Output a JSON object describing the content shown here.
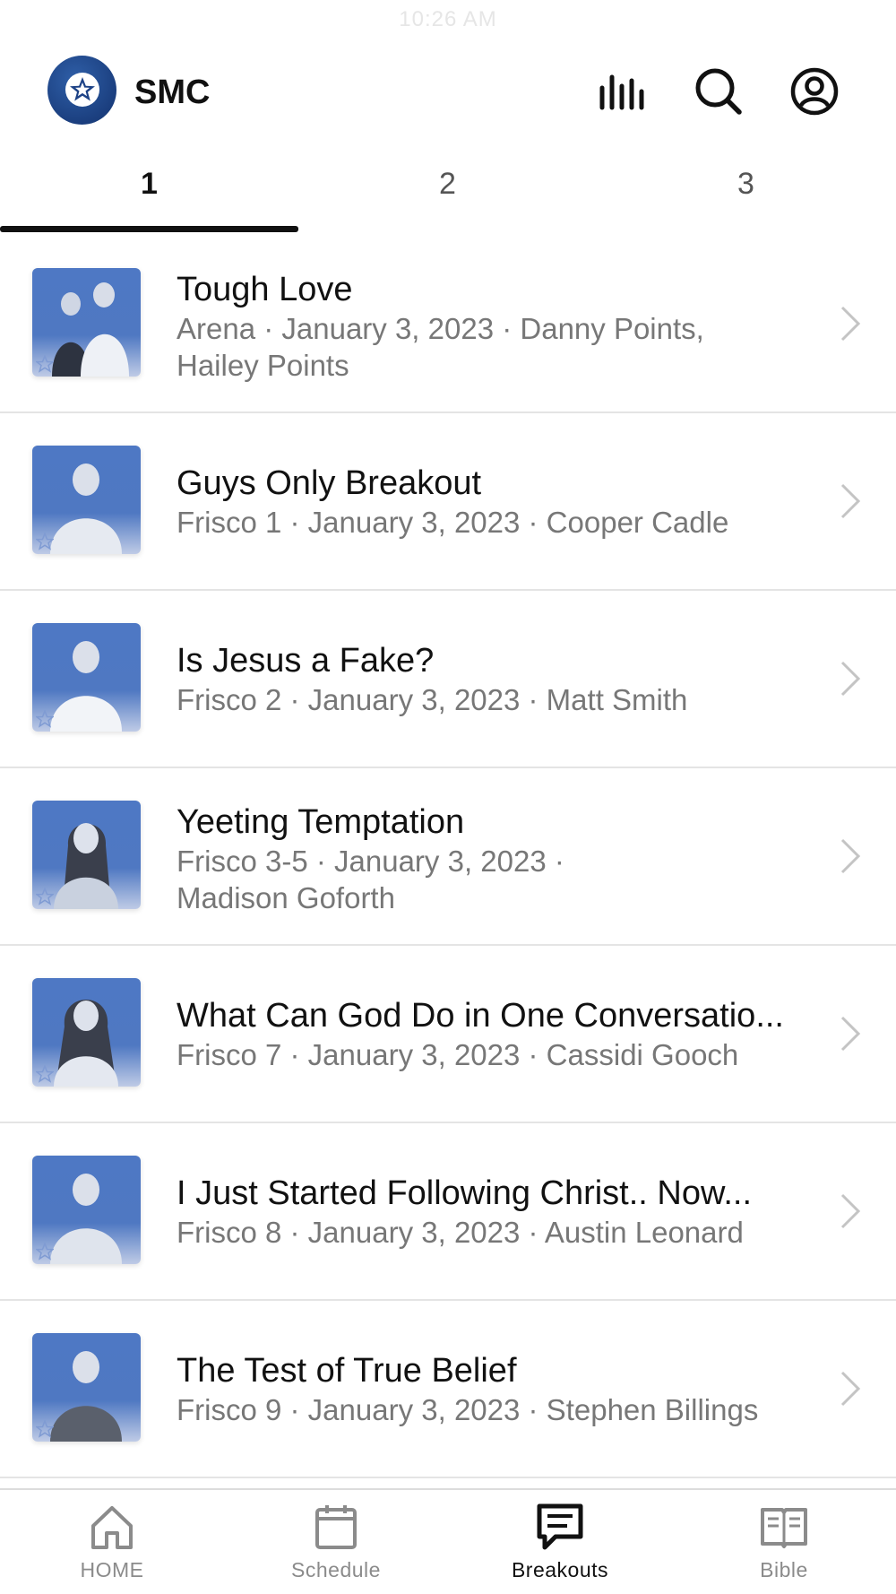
{
  "status": {
    "time": "10:26 AM"
  },
  "header": {
    "app_name": "SMC",
    "icons": [
      "stats-icon",
      "search-icon",
      "profile-icon"
    ]
  },
  "tabs": [
    {
      "label": "1",
      "active": true
    },
    {
      "label": "2",
      "active": false
    },
    {
      "label": "3",
      "active": false
    }
  ],
  "sessions": [
    {
      "title": "Tough Love",
      "subtitle_line1": "Arena · January 3, 2023 · Danny Points,",
      "subtitle_line2": "Hailey Points"
    },
    {
      "title": "Guys Only Breakout",
      "subtitle_line1": "Frisco 1 · January 3, 2023 · Cooper Cadle",
      "subtitle_line2": ""
    },
    {
      "title": "Is Jesus a Fake?",
      "subtitle_line1": "Frisco 2 · January 3, 2023 · Matt Smith",
      "subtitle_line2": ""
    },
    {
      "title": "Yeeting Temptation",
      "subtitle_line1": "Frisco 3-5 · January 3, 2023 ·",
      "subtitle_line2": "Madison Goforth"
    },
    {
      "title": "What Can God Do in One Conversatio...",
      "subtitle_line1": "Frisco 7 · January 3, 2023 · Cassidi Gooch",
      "subtitle_line2": ""
    },
    {
      "title": "I Just Started Following Christ.. Now...",
      "subtitle_line1": "Frisco 8 · January 3, 2023 · Austin Leonard",
      "subtitle_line2": ""
    },
    {
      "title": "The Test of True Belief",
      "subtitle_line1": "Frisco 9 · January 3, 2023 · Stephen Billings",
      "subtitle_line2": ""
    }
  ],
  "bottom_nav": [
    {
      "label": "HOME",
      "icon": "home-icon",
      "active": false
    },
    {
      "label": "Schedule",
      "icon": "calendar-icon",
      "active": false
    },
    {
      "label": "Breakouts",
      "icon": "chat-icon",
      "active": true
    },
    {
      "label": "Bible",
      "icon": "book-icon",
      "active": false
    }
  ],
  "colors": {
    "accent": "#1b3f7f",
    "thumb_blue": "#4e78c4",
    "muted_text": "#777777"
  }
}
